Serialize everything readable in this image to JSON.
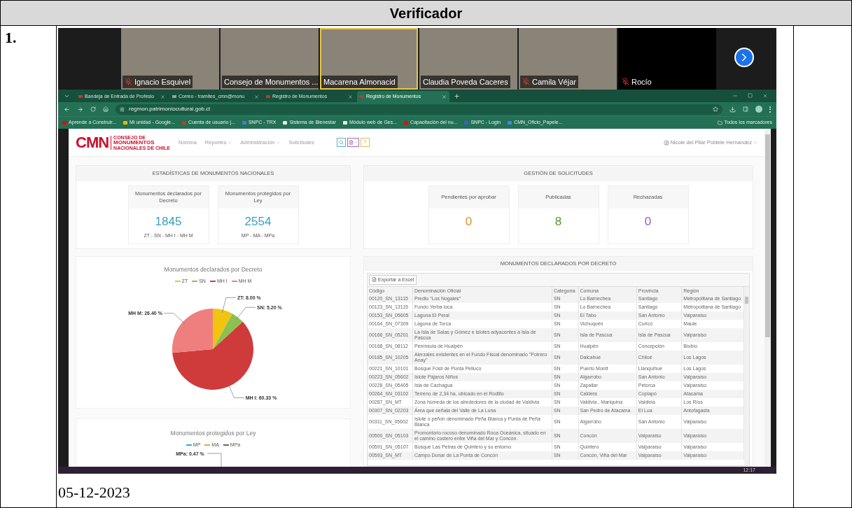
{
  "document": {
    "header": "Verificador",
    "row_number": "1.",
    "date": "05-12-2023"
  },
  "video_call": {
    "participants": [
      {
        "name": "Ignacio Esquivel",
        "muted": true,
        "speaking": false,
        "video": true
      },
      {
        "name": "Consejo de Monumentos ...",
        "muted": false,
        "speaking": false,
        "video": true
      },
      {
        "name": "Macarena Almonacid",
        "muted": false,
        "speaking": true,
        "video": true
      },
      {
        "name": "Claudia Poveda Caceres",
        "muted": false,
        "speaking": false,
        "video": true
      },
      {
        "name": "Camila Véjar",
        "muted": true,
        "speaking": false,
        "video": true
      },
      {
        "name": "Rocío",
        "muted": true,
        "speaking": false,
        "video": false
      }
    ]
  },
  "browser": {
    "tabs": [
      {
        "title": "Bandeja de Entrada de Profesio",
        "color": "#c0392b",
        "selected": false
      },
      {
        "title": "Correo - tramites_cmn@monu",
        "color": "#9aa0a6",
        "selected": false
      },
      {
        "title": "Registro de Monumentos",
        "color": "#c0392b",
        "selected": false
      },
      {
        "title": "Registro de Monumentos",
        "color": "#c0392b",
        "selected": true
      }
    ],
    "address": "regmon.patrimoniocultural.gob.cl",
    "bookmarks": [
      {
        "label": "Aprende a Construir...",
        "color": "#ff0000"
      },
      {
        "label": "Mi unidad - Google...",
        "color": "#f4b400"
      },
      {
        "label": "Cuenta de usuario |...",
        "color": "#c0392b"
      },
      {
        "label": "SNPC - TRX",
        "color": "#4a7bd0"
      },
      {
        "label": "Sistema de Bienestar",
        "color": "#e8eaed"
      },
      {
        "label": "Módulo web de Ges...",
        "color": "#e8eaed"
      },
      {
        "label": "Capacitación del nu...",
        "color": "#ff0000"
      },
      {
        "label": "SNPC - Login",
        "color": "#3b5bdb"
      },
      {
        "label": "CMN_Oficio_Papele...",
        "color": "#4285f4"
      }
    ],
    "all_bookmarks": "Todos los marcadores"
  },
  "app": {
    "logo": {
      "mark": "CMN",
      "lines": [
        "CONSEJO DE",
        "MONUMENTOS",
        "NACIONALES DE CHILE"
      ]
    },
    "nav": [
      {
        "label": "Nómina",
        "dropdown": false
      },
      {
        "label": "Reportes",
        "dropdown": true
      },
      {
        "label": "Administración",
        "dropdown": true
      },
      {
        "label": "Solicitudes",
        "dropdown": false
      }
    ],
    "help_button": "?",
    "user": "Nicole del Pilar Poblete Hernandez",
    "stats": {
      "title": "ESTADÍSTICAS DE MONUMENTOS NACIONALES",
      "cards": [
        {
          "title": "Monumentos declarados por Decreto",
          "value": "1845",
          "subtitle": "ZT - SN - MH I - MH M"
        },
        {
          "title": "Monumentos protegidos por Ley",
          "value": "2554",
          "subtitle": "MP - MA - MPa"
        }
      ]
    },
    "chart_1": {
      "chart_data": {
        "type": "pie",
        "title": "Monumentos declarados por Decreto",
        "categories": [
          "ZT",
          "SN",
          "MH I",
          "MH M"
        ],
        "values": [
          8.0,
          5.2,
          60.33,
          26.4
        ],
        "legend": "top",
        "colors": [
          "#f1c40f",
          "#8cc152",
          "#cf3b3b",
          "#ef7f7f"
        ],
        "value_labels": [
          "ZT: 8.00 %",
          "SN: 5.20 %",
          "MH I: 60.33 %",
          "MH M: 26.40 %"
        ]
      }
    },
    "chart_2": {
      "title": "Monumentos protegidos por Ley",
      "legend": [
        {
          "name": "MP",
          "color": "#3fa9d6"
        },
        {
          "name": "MA",
          "color": "#e8a33d"
        },
        {
          "name": "MPa",
          "color": "#8b5a5a"
        }
      ],
      "label": "MPa: 0.47 %"
    },
    "requests": {
      "title": "GESTIÓN DE SOLICITUDES",
      "cards": [
        {
          "title": "Pendientes por aprobar",
          "value": "0",
          "color": "#e0902f"
        },
        {
          "title": "Publicadas",
          "value": "8",
          "color": "#4e9a2e"
        },
        {
          "title": "Rechazadas",
          "value": "0",
          "color": "#9b59b6"
        }
      ]
    },
    "table": {
      "title": "MONUMENTOS DECLARADOS POR DECRETO",
      "export_button": "Exportar a Excel",
      "columns": [
        "Código",
        "Denominación Oficial",
        "Categoría",
        "Comuna",
        "Provincia",
        "Región"
      ],
      "rows": [
        [
          "00120_SN_13115",
          "Predio \"Los Nogales\"",
          "SN",
          "Lo Barnechea",
          "Santiago",
          "Metropolitana de Santiago"
        ],
        [
          "00123_SN_13115",
          "Fundo Yerba loca",
          "SN",
          "Lo Barnechea",
          "Santiago",
          "Metropolitana de Santiago"
        ],
        [
          "00153_SN_05605",
          "Laguna El Peral",
          "SN",
          "El Tabo",
          "San Antonio",
          "Valparaíso"
        ],
        [
          "00164_SN_07309",
          "Laguna de Torca",
          "SN",
          "Vichuquén",
          "Curicó",
          "Maule"
        ],
        [
          "00166_SN_05201",
          "La Isla de Salas y Gómez e islotes adyacentes a Isla de Pascua",
          "SN",
          "Isla de Pascua",
          "Isla de Pascua",
          "Valparaíso"
        ],
        [
          "00168_SN_08112",
          "Península de Hualpén",
          "SN",
          "Hualpén",
          "Concepción",
          "Biobío"
        ],
        [
          "00185_SN_10205",
          "Alerzales existentes en el Fundo Fiscal denominado \"Potrero Anay\"",
          "SN",
          "Dalcahue",
          "Chiloé",
          "Los Lagos"
        ],
        [
          "00221_SN_10101",
          "Bosque Fósil de Punta Pelluco",
          "SN",
          "Puerto Montt",
          "Llanquihue",
          "Los Lagos"
        ],
        [
          "00223_SN_05602",
          "Islote Pájaros Niños",
          "SN",
          "Algarrobo",
          "San Antonio",
          "Valparaíso"
        ],
        [
          "00228_SN_05405",
          "Isla de Cachagua",
          "SN",
          "Zapallar",
          "Petorca",
          "Valparaíso"
        ],
        [
          "00264_SN_03102",
          "Terreno de 2,34 ha, ubicado en el Rodillo",
          "SN",
          "Caldera",
          "Copiapó",
          "Atacama"
        ],
        [
          "00287_SN_MT",
          "Zona húmeda de los alrededores de la ciudad de Valdivia",
          "SN",
          "Valdivia , Mariquina",
          "Valdivia",
          "Los Ríos"
        ],
        [
          "00307_SN_02203",
          "Área que señala del Valle de La Luna",
          "SN",
          "San Pedro de Atacama",
          "El Loa",
          "Antofagasta"
        ],
        [
          "00311_SN_05602",
          "Islote o peñón denominado Peña Blanca y Punta de Peña Blanca",
          "SN",
          "Algarrobo",
          "San Antonio",
          "Valparaíso"
        ],
        [
          "00500_SN_05103",
          "Promontorio rocoso denominado Roca Oceánica, situado en el camino costero entre Viña del Mar y Concón.",
          "SN",
          "Concón",
          "Valparaíso",
          "Valparaíso"
        ],
        [
          "00591_SN_05107",
          "Bosque Las Petras de Quintero y su entorno",
          "SN",
          "Quintero",
          "Valparaíso",
          "Valparaíso"
        ],
        [
          "00593_SN_MT",
          "Campo Dunar de La Punta de Concón",
          "SN",
          "Concón, Viña del Mar",
          "Valparaíso",
          "Valparaíso"
        ]
      ]
    }
  },
  "taskbar": {
    "time": "12:17"
  }
}
